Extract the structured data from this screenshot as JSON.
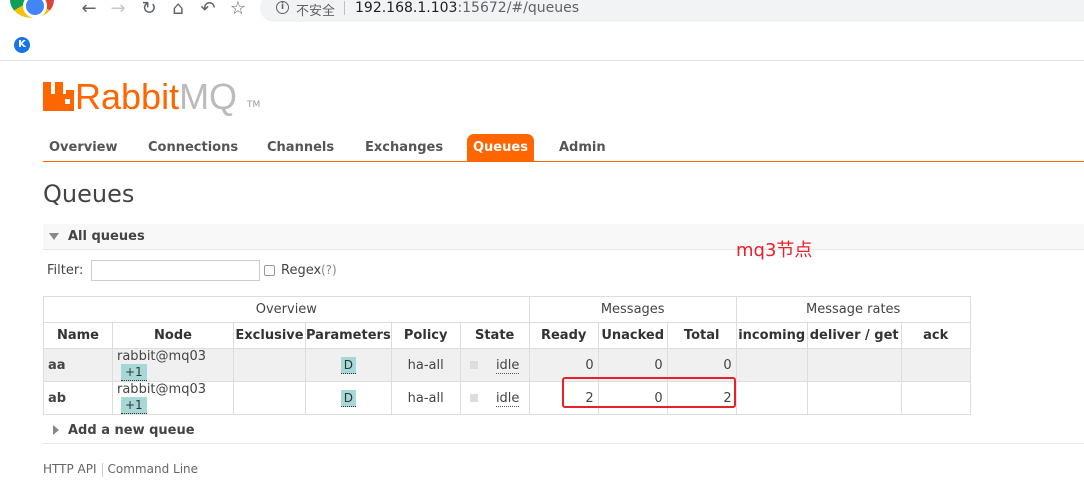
{
  "browser": {
    "insecure_label": "不安全",
    "url_host": "192.168.1.103",
    "url_rest": ":15672/#/queues",
    "bookmark_icon": "K"
  },
  "logo": {
    "rabbit": "Rabbit",
    "mq": "MQ",
    "tm": "TM"
  },
  "tabs": [
    {
      "label": "Overview",
      "active": false
    },
    {
      "label": "Connections",
      "active": false
    },
    {
      "label": "Channels",
      "active": false
    },
    {
      "label": "Exchanges",
      "active": false
    },
    {
      "label": "Queues",
      "active": true
    },
    {
      "label": "Admin",
      "active": false
    }
  ],
  "page_title": "Queues",
  "section_title": "All queues",
  "annotation": "mq3节点",
  "filter": {
    "label": "Filter:",
    "value": "",
    "regex_label": "Regex",
    "regex_help": "(?)"
  },
  "table": {
    "groups": [
      "Overview",
      "Messages",
      "Message rates"
    ],
    "columns": [
      "Name",
      "Node",
      "Exclusive",
      "Parameters",
      "Policy",
      "State",
      "Ready",
      "Unacked",
      "Total",
      "incoming",
      "deliver / get",
      "ack"
    ],
    "rows": [
      {
        "name": "aa",
        "node": "rabbit@mq03",
        "node_badge": "+1",
        "exclusive": "",
        "param": "D",
        "policy": "ha-all",
        "state": "idle",
        "ready": "0",
        "unacked": "0",
        "total": "0",
        "incoming": "",
        "deliver": "",
        "ack": ""
      },
      {
        "name": "ab",
        "node": "rabbit@mq03",
        "node_badge": "+1",
        "exclusive": "",
        "param": "D",
        "policy": "ha-all",
        "state": "idle",
        "ready": "2",
        "unacked": "0",
        "total": "2",
        "incoming": "",
        "deliver": "",
        "ack": ""
      }
    ]
  },
  "add_queue": "Add a new queue",
  "footer": {
    "http_api": "HTTP API",
    "command_line": "Command Line"
  },
  "colors": {
    "accent": "#ff6600",
    "annotation": "#e8202a",
    "badge": "#a7d8d8"
  }
}
